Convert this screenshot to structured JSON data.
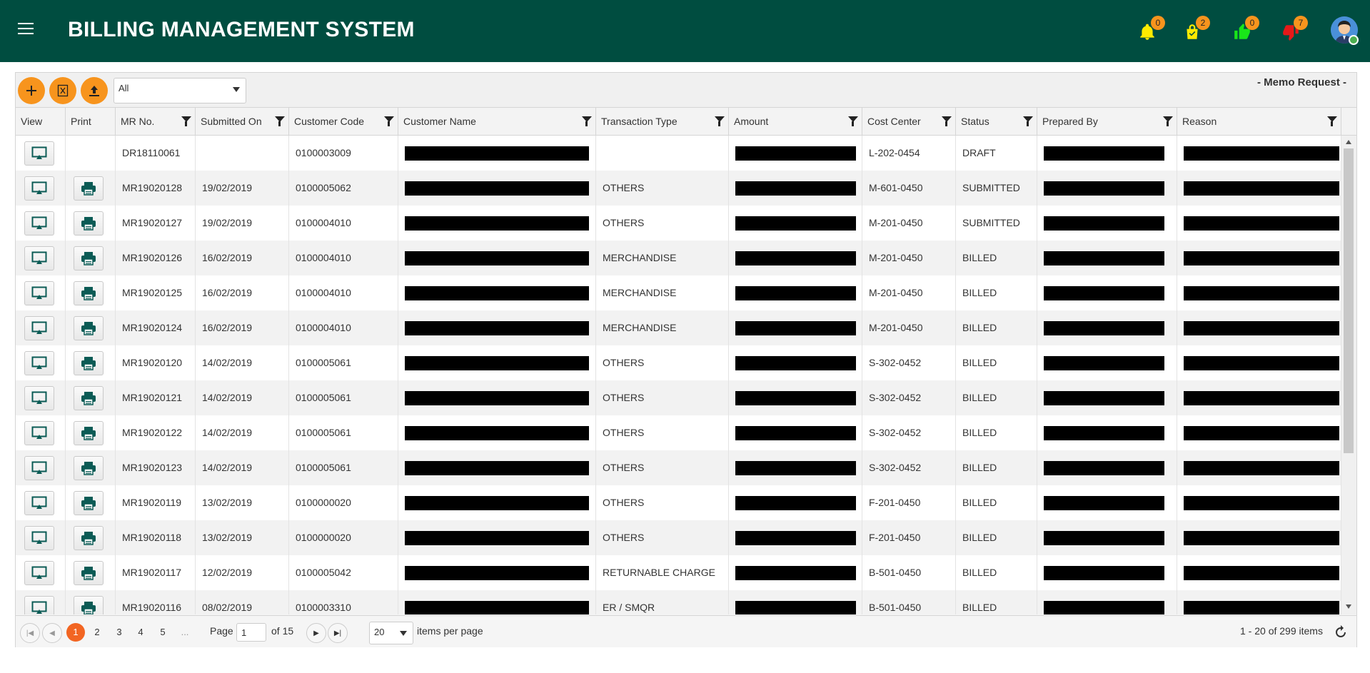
{
  "header": {
    "title": "BILLING MANAGEMENT SYSTEM"
  },
  "notifications": [
    {
      "icon": "bell-icon",
      "count": "0",
      "color": "#ffeb00"
    },
    {
      "icon": "shopping-bag-icon",
      "count": "2",
      "color": "#ffeb00"
    },
    {
      "icon": "thumbs-up-icon",
      "count": "0",
      "color": "#19e619"
    },
    {
      "icon": "thumbs-down-icon",
      "count": "7",
      "color": "#e61919"
    }
  ],
  "toolbar": {
    "filter_value": "All",
    "grid_title": "- Memo Request -",
    "buttons": [
      "plus-icon",
      "excel-export-icon",
      "upload-icon"
    ]
  },
  "columns": [
    "View",
    "Print",
    "MR No.",
    "Submitted On",
    "Customer Code",
    "Customer Name",
    "Transaction Type",
    "Amount",
    "Cost Center",
    "Status",
    "Prepared By",
    "Reason"
  ],
  "rows": [
    {
      "mr": "DR18110061",
      "date": "",
      "code": "0100003009",
      "type": "",
      "cc": "L-202-0454",
      "status": "DRAFT",
      "print": false
    },
    {
      "mr": "MR19020128",
      "date": "19/02/2019",
      "code": "0100005062",
      "type": "OTHERS",
      "cc": "M-601-0450",
      "status": "SUBMITTED",
      "print": true
    },
    {
      "mr": "MR19020127",
      "date": "19/02/2019",
      "code": "0100004010",
      "type": "OTHERS",
      "cc": "M-201-0450",
      "status": "SUBMITTED",
      "print": true
    },
    {
      "mr": "MR19020126",
      "date": "16/02/2019",
      "code": "0100004010",
      "type": "MERCHANDISE",
      "cc": "M-201-0450",
      "status": "BILLED",
      "print": true
    },
    {
      "mr": "MR19020125",
      "date": "16/02/2019",
      "code": "0100004010",
      "type": "MERCHANDISE",
      "cc": "M-201-0450",
      "status": "BILLED",
      "print": true
    },
    {
      "mr": "MR19020124",
      "date": "16/02/2019",
      "code": "0100004010",
      "type": "MERCHANDISE",
      "cc": "M-201-0450",
      "status": "BILLED",
      "print": true
    },
    {
      "mr": "MR19020120",
      "date": "14/02/2019",
      "code": "0100005061",
      "type": "OTHERS",
      "cc": "S-302-0452",
      "status": "BILLED",
      "print": true
    },
    {
      "mr": "MR19020121",
      "date": "14/02/2019",
      "code": "0100005061",
      "type": "OTHERS",
      "cc": "S-302-0452",
      "status": "BILLED",
      "print": true
    },
    {
      "mr": "MR19020122",
      "date": "14/02/2019",
      "code": "0100005061",
      "type": "OTHERS",
      "cc": "S-302-0452",
      "status": "BILLED",
      "print": true
    },
    {
      "mr": "MR19020123",
      "date": "14/02/2019",
      "code": "0100005061",
      "type": "OTHERS",
      "cc": "S-302-0452",
      "status": "BILLED",
      "print": true
    },
    {
      "mr": "MR19020119",
      "date": "13/02/2019",
      "code": "0100000020",
      "type": "OTHERS",
      "cc": "F-201-0450",
      "status": "BILLED",
      "print": true
    },
    {
      "mr": "MR19020118",
      "date": "13/02/2019",
      "code": "0100000020",
      "type": "OTHERS",
      "cc": "F-201-0450",
      "status": "BILLED",
      "print": true
    },
    {
      "mr": "MR19020117",
      "date": "12/02/2019",
      "code": "0100005042",
      "type": "RETURNABLE CHARGE",
      "cc": "B-501-0450",
      "status": "BILLED",
      "print": true
    },
    {
      "mr": "MR19020116",
      "date": "08/02/2019",
      "code": "0100003310",
      "type": "ER / SMQR",
      "cc": "B-501-0450",
      "status": "BILLED",
      "print": true
    }
  ],
  "pager": {
    "pages": [
      "1",
      "2",
      "3",
      "4",
      "5",
      "..."
    ],
    "page_label": "Page",
    "current_page": "1",
    "of_label": "of 15",
    "page_size": "20",
    "items_per_page_label": "items per page",
    "summary": "1 - 20 of 299 items"
  }
}
